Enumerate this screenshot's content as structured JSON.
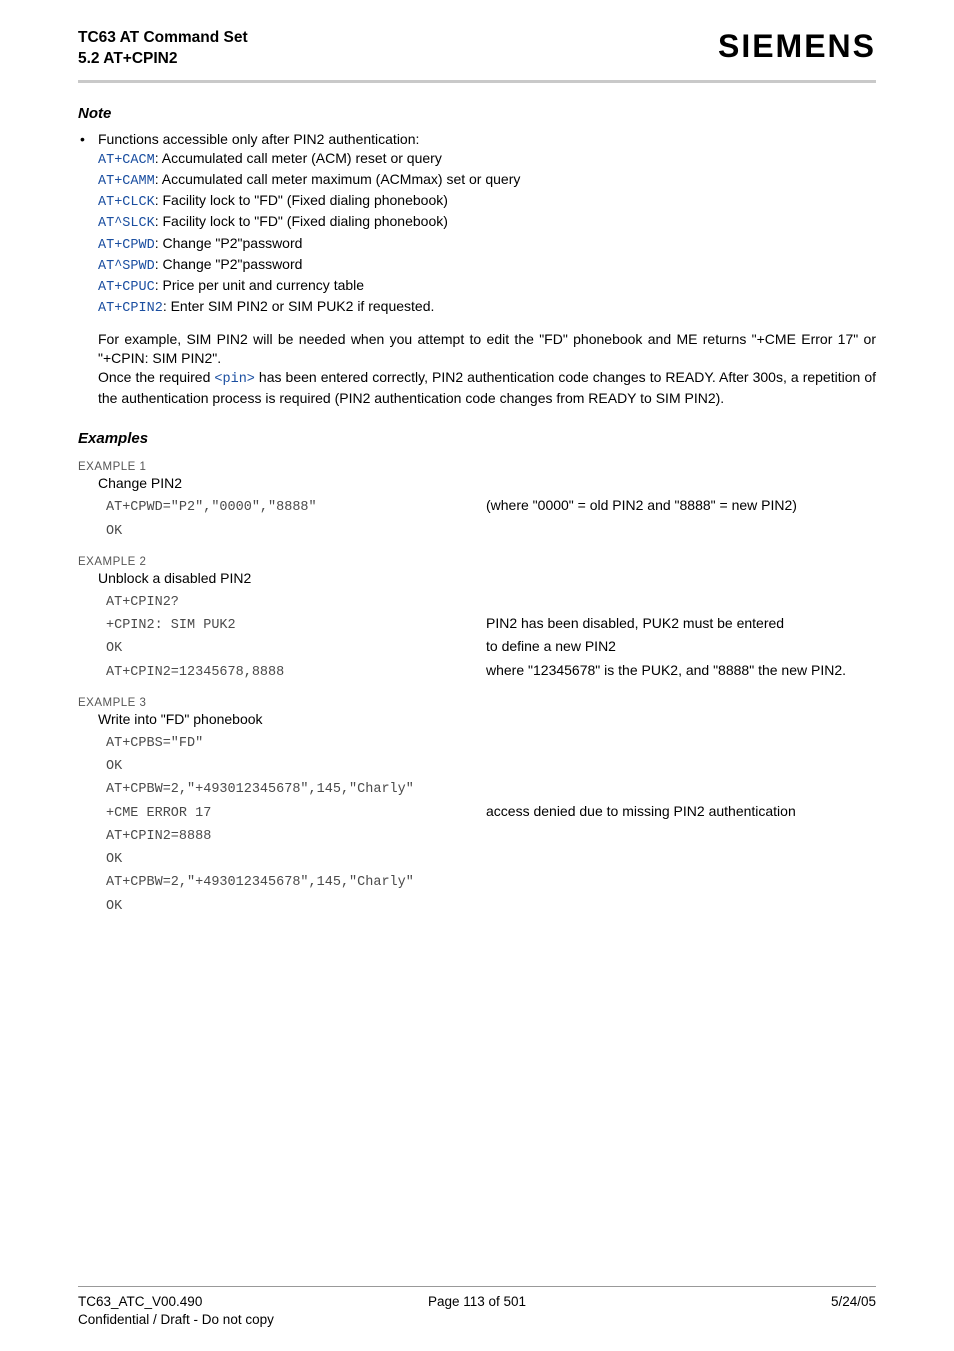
{
  "header": {
    "title": "TC63 AT Command Set",
    "section": "5.2 AT+CPIN2",
    "logo": "SIEMENS"
  },
  "note": {
    "heading": "Note",
    "bullet_lead": "Functions accessible only after PIN2 authentication:",
    "items": [
      {
        "cmd": "AT+CACM",
        "desc": ": Accumulated call meter (ACM) reset or query"
      },
      {
        "cmd": "AT+CAMM",
        "desc": ": Accumulated call meter maximum (ACMmax) set or query"
      },
      {
        "cmd": "AT+CLCK",
        "desc": ": Facility lock to \"FD\" (Fixed dialing phonebook)"
      },
      {
        "cmd": "AT^SLCK",
        "desc": ": Facility lock to \"FD\" (Fixed dialing phonebook)"
      },
      {
        "cmd": "AT+CPWD",
        "desc": ": Change \"P2\"password"
      },
      {
        "cmd": "AT^SPWD",
        "desc": ": Change \"P2\"password"
      },
      {
        "cmd": "AT+CPUC",
        "desc": ": Price per unit and currency table"
      },
      {
        "cmd": "AT+CPIN2",
        "desc": ": Enter SIM PIN2 or SIM PUK2 if requested."
      }
    ],
    "para1": "For example, SIM PIN2 will be needed when you attempt to edit the \"FD\" phonebook and ME returns \"+CME Error 17\" or \"+CPIN: SIM PIN2\".",
    "para2a": "Once the required ",
    "para2_pin": "<pin>",
    "para2b": " has been entered correctly, PIN2 authentication code changes to READY. After 300s, a repetition of the authentication process is required (PIN2 authentication code changes from READY to SIM PIN2)."
  },
  "examples": {
    "heading": "Examples",
    "ex1": {
      "label": "EXAMPLE 1",
      "title": "Change PIN2",
      "lines": [
        {
          "code": "AT+CPWD=\"P2\",\"0000\",\"8888\"",
          "note": "(where \"0000\" = old PIN2 and \"8888\" = new PIN2)"
        },
        {
          "code": "OK",
          "note": ""
        }
      ]
    },
    "ex2": {
      "label": "EXAMPLE 2",
      "title": "Unblock a disabled PIN2",
      "lines": [
        {
          "code": "AT+CPIN2?",
          "note": ""
        },
        {
          "code": "+CPIN2: SIM PUK2",
          "note": "PIN2 has been disabled, PUK2 must be entered"
        },
        {
          "code": "OK",
          "note": "to define a new PIN2"
        },
        {
          "code": "AT+CPIN2=12345678,8888",
          "note": "where \"12345678\" is the PUK2, and \"8888\" the new PIN2."
        }
      ]
    },
    "ex3": {
      "label": "EXAMPLE 3",
      "title": "Write into \"FD\" phonebook",
      "lines": [
        {
          "code": "AT+CPBS=\"FD\"",
          "note": ""
        },
        {
          "code": "OK",
          "note": ""
        },
        {
          "code": "AT+CPBW=2,\"+493012345678\",145,\"Charly\"",
          "note": ""
        },
        {
          "code": "+CME ERROR 17",
          "note": "access denied due to missing PIN2 authentication"
        },
        {
          "code": "AT+CPIN2=8888",
          "note": ""
        },
        {
          "code": "OK",
          "note": ""
        },
        {
          "code": "AT+CPBW=2,\"+493012345678\",145,\"Charly\"",
          "note": ""
        },
        {
          "code": "OK",
          "note": ""
        }
      ]
    }
  },
  "footer": {
    "left1": "TC63_ATC_V00.490",
    "left2": "Confidential / Draft - Do not copy",
    "center": "Page 113 of 501",
    "right": "5/24/05"
  }
}
